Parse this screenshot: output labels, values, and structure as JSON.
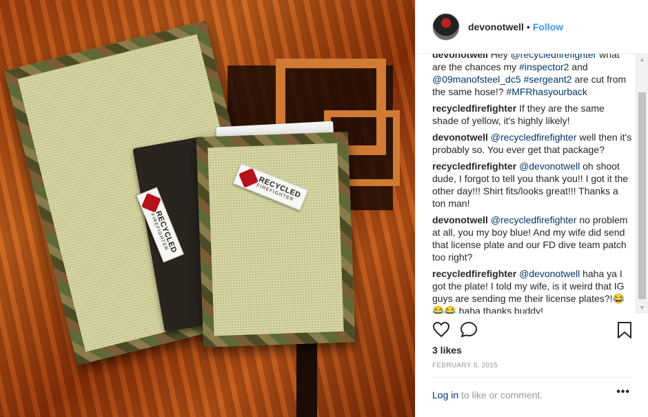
{
  "post": {
    "username": "devonotwell",
    "separator": "•",
    "follow_label": "Follow",
    "photo_tags": {
      "tag_text": "RECYCLED",
      "tag_sub": "FIREFIGHTER"
    }
  },
  "comments": [
    {
      "user": "devonotwell",
      "parts": [
        {
          "t": "Hey "
        },
        {
          "m": "@recycledfirefighter"
        },
        {
          "t": " what are the chances my "
        },
        {
          "m": "#inspector2"
        },
        {
          "t": " and "
        },
        {
          "m": "@09manofsteel_dc5"
        },
        {
          "t": " "
        },
        {
          "m": "#sergeant2"
        },
        {
          "t": " are cut from the same hose!? "
        },
        {
          "m": "#MFRhasyourback"
        }
      ]
    },
    {
      "user": "recycledfirefighter",
      "parts": [
        {
          "t": "If they are the same shade of yellow, it's highly likely!"
        }
      ]
    },
    {
      "user": "devonotwell",
      "parts": [
        {
          "m": "@recycledfirefighter"
        },
        {
          "t": " well then it's probably so. You ever get that package?"
        }
      ]
    },
    {
      "user": "recycledfirefighter",
      "parts": [
        {
          "m": "@devonotwell"
        },
        {
          "t": " oh shoot dude, I forgot to tell you thank you!! I got it the other day!!! Shirt fits/looks great!!! Thanks a ton man!"
        }
      ]
    },
    {
      "user": "devonotwell",
      "parts": [
        {
          "m": "@recycledfirefighter"
        },
        {
          "t": " no problem at all, you my boy blue! And my wife did send that license plate and our FD dive team patch too right?"
        }
      ]
    },
    {
      "user": "recycledfirefighter",
      "parts": [
        {
          "m": "@devonotwell"
        },
        {
          "t": " haha ya I got the plate! I told my wife, is it weird that IG guys are sending me their license plates?!😂😂😂 haha thanks buddy!"
        }
      ]
    }
  ],
  "stats": {
    "likes": "3 likes",
    "date": "FEBRUARY 8, 2015"
  },
  "footer": {
    "login_link": "Log in",
    "login_rest": " to like or comment.",
    "more": "•••"
  },
  "icons": {
    "like": "heart-icon",
    "comment": "comment-bubble-icon",
    "save": "bookmark-icon",
    "scroll_up": "scroll-up-arrow-icon",
    "scroll_down": "scroll-down-arrow-icon"
  },
  "colors": {
    "link": "#003569",
    "follow": "#3897f0",
    "muted": "#999999"
  }
}
